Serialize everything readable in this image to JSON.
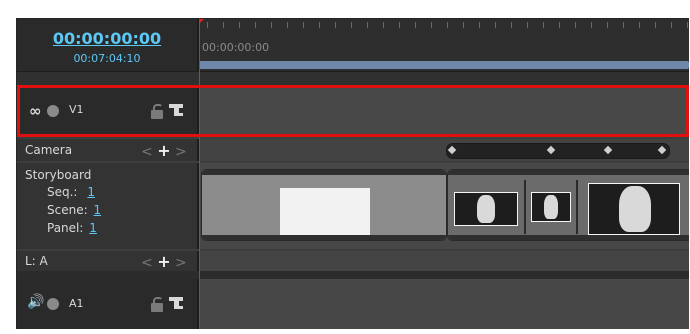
{
  "timecode": {
    "current": "00:00:00:00",
    "duration": "00:07:04:10"
  },
  "ruler": {
    "start_label": "00:00:00:00"
  },
  "tracks": {
    "v1": {
      "label": "V1"
    },
    "camera": {
      "label": "Camera",
      "prev": "<",
      "add": "+",
      "next": ">"
    },
    "storyboard": {
      "label": "Storyboard",
      "seq_label": "Seq.:",
      "seq_value": "1",
      "scene_label": "Scene:",
      "scene_value": "1",
      "panel_label": "Panel:",
      "panel_value": "1"
    },
    "layer": {
      "label": "L: A",
      "prev": "<",
      "add": "+",
      "next": ">"
    },
    "a1": {
      "label": "A1"
    }
  },
  "colors": {
    "accent": "#5cc8f5",
    "playhead": "#d92a2a",
    "highlight": "#e01010",
    "ruler_bar": "#6f87a8"
  },
  "icons": [
    "link-icon",
    "visibility-circle-icon",
    "lock-icon",
    "track-tool-icon",
    "speaker-icon",
    "keyframe-icon"
  ]
}
